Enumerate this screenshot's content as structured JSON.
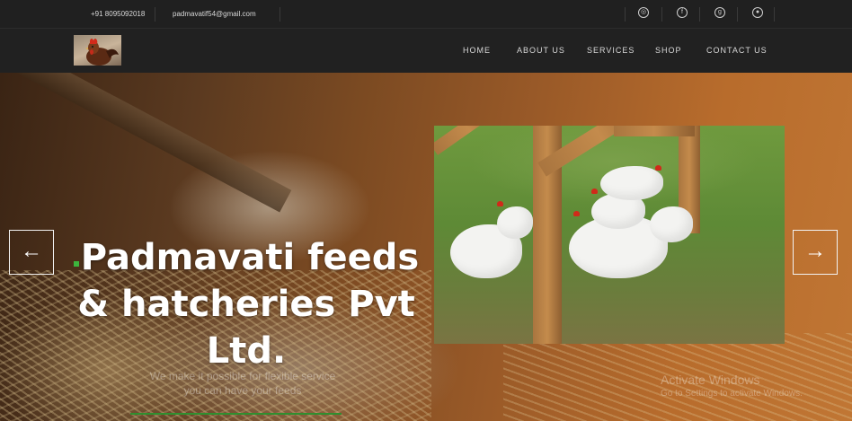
{
  "topbar": {
    "phone": "+91 8095092018",
    "email": "padmavatif54@gmail.com",
    "social_icons": [
      "instagram-icon",
      "facebook-icon",
      "google-plus-icon",
      "pinterest-icon"
    ]
  },
  "nav": {
    "items": [
      {
        "label": "HOME"
      },
      {
        "label": "ABOUT US"
      },
      {
        "label": "SERVICES"
      },
      {
        "label": "SHOP"
      },
      {
        "label": "CONTACT US"
      }
    ]
  },
  "hero": {
    "title_line1": "Padmavati feeds",
    "title_line2": "& hatcheries Pvt",
    "title_line3": "Ltd.",
    "subtitle_line1": "We make it possible for flexible service",
    "subtitle_line2": "you can have your feeds",
    "prev_arrow": "←",
    "next_arrow": "→"
  },
  "watermark": {
    "title": "Activate Windows",
    "subtitle": "Go to Settings to activate Windows."
  },
  "colors": {
    "topbar_bg": "#202020",
    "nav_bg": "#212121",
    "accent_green": "#3db53d"
  }
}
